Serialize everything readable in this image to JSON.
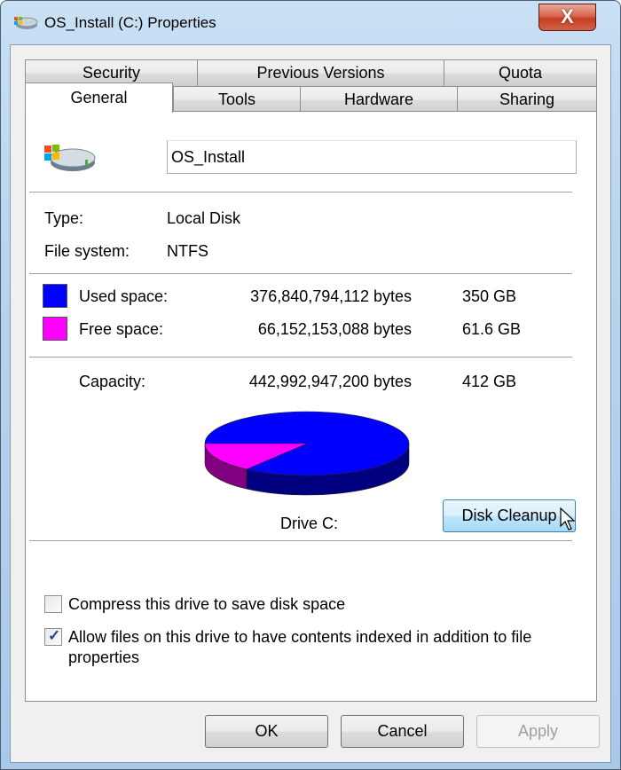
{
  "window": {
    "title": "OS_Install (C:) Properties",
    "title_icon": "drive-icon",
    "close_label": "X"
  },
  "tabs": {
    "row_back": [
      {
        "label": "Security"
      },
      {
        "label": "Previous Versions"
      },
      {
        "label": "Quota"
      }
    ],
    "row_front": [
      {
        "label": "General",
        "active": true
      },
      {
        "label": "Tools"
      },
      {
        "label": "Hardware"
      },
      {
        "label": "Sharing"
      }
    ]
  },
  "general": {
    "drive_name_value": "OS_Install",
    "type_label": "Type:",
    "type_value": "Local Disk",
    "fs_label": "File system:",
    "fs_value": "NTFS",
    "used": {
      "label": "Used space:",
      "bytes": "376,840,794,112 bytes",
      "size": "350 GB",
      "color": "#0000ff"
    },
    "free": {
      "label": "Free space:",
      "bytes": "66,152,153,088 bytes",
      "size": "61.6 GB",
      "color": "#ff00ff"
    },
    "capacity": {
      "label": "Capacity:",
      "bytes": "442,992,947,200 bytes",
      "size": "412 GB"
    },
    "drive_label": "Drive C:",
    "disk_cleanup_label": "Disk Cleanup",
    "compress": {
      "label": "Compress this drive to save disk space",
      "checked": false
    },
    "index": {
      "label_line1": "Allow files on this drive to have contents indexed in addition to file",
      "label_line2": "properties",
      "checked": true
    }
  },
  "buttons": {
    "ok": "OK",
    "cancel": "Cancel",
    "apply": "Apply"
  },
  "chart_data": {
    "type": "pie",
    "title": "Drive C:",
    "categories": [
      "Used space",
      "Free space"
    ],
    "values": [
      376840794112,
      66152153088
    ],
    "colors": [
      "#0000ff",
      "#ff00ff"
    ],
    "side_colors": [
      "#000080",
      "#800080"
    ]
  }
}
